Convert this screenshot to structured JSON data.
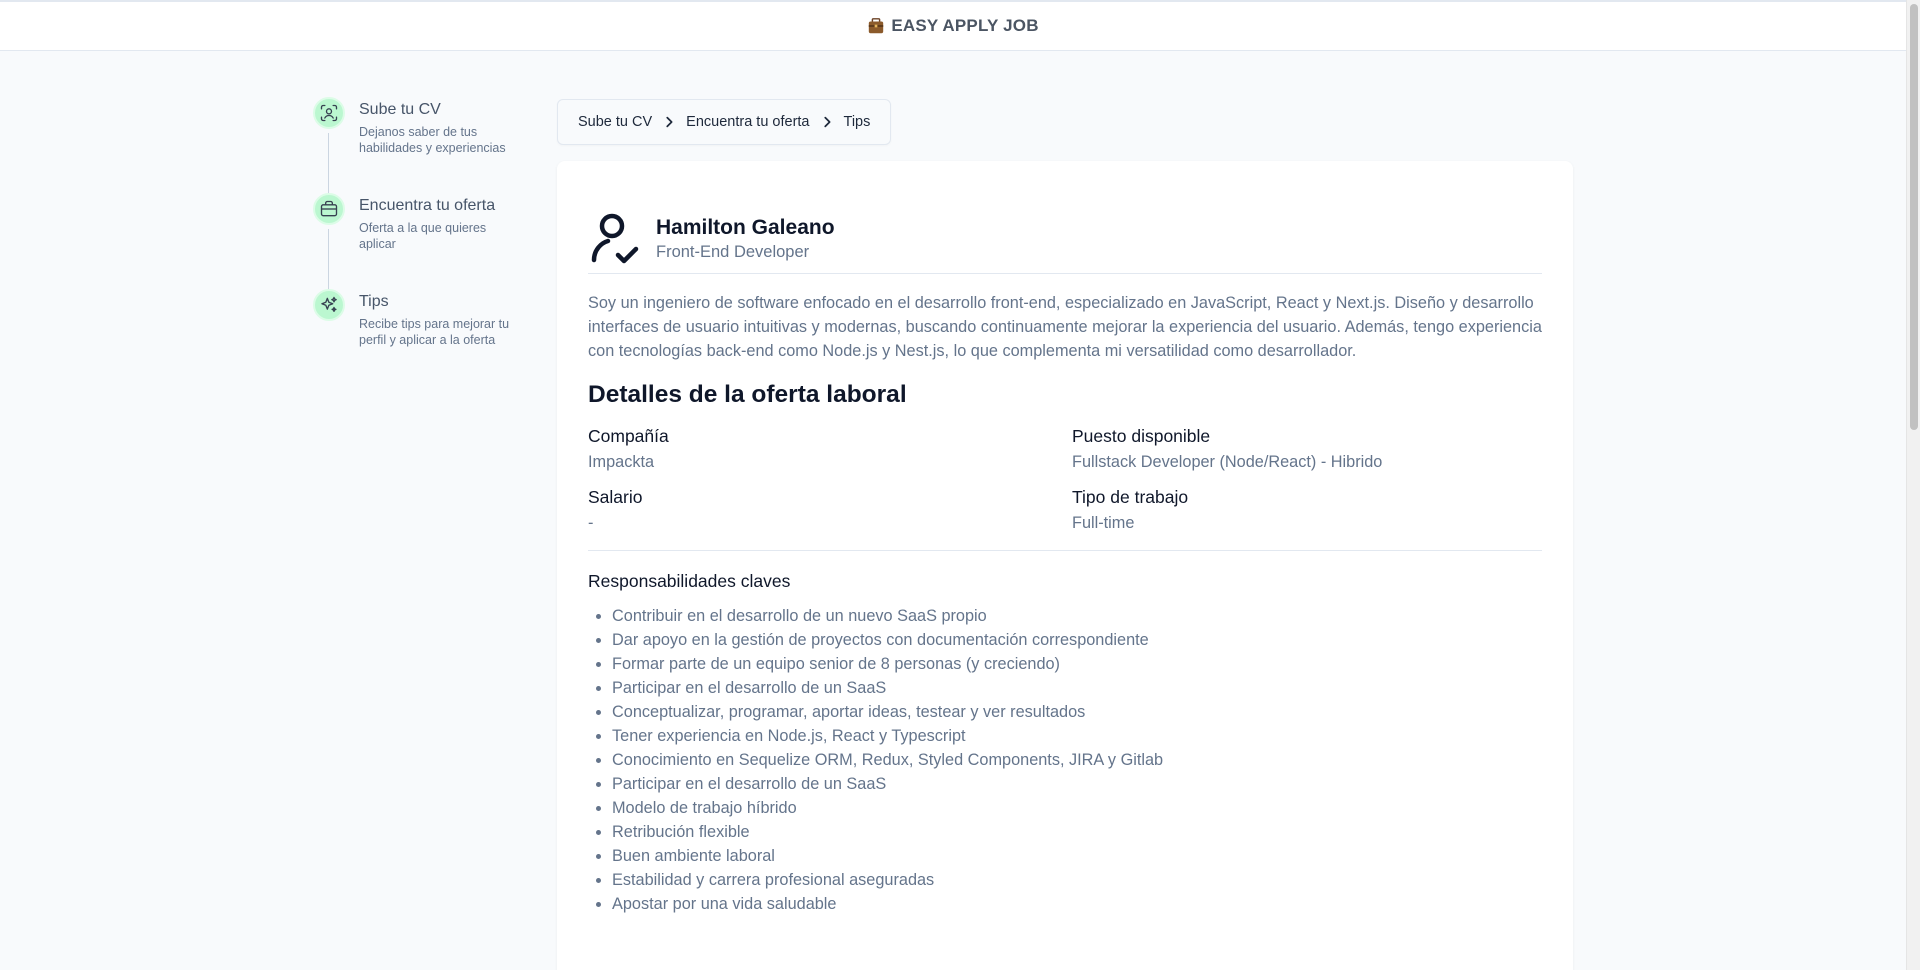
{
  "header": {
    "brand": "EASY APPLY JOB",
    "brand_icon": "briefcase-icon"
  },
  "stepper": {
    "steps": [
      {
        "title": "Sube tu CV",
        "desc": "Dejanos saber de tus habilidades y experiencias",
        "icon": "scan-user-icon"
      },
      {
        "title": "Encuentra tu oferta",
        "desc": "Oferta a la que quieres aplicar",
        "icon": "briefcase-icon"
      },
      {
        "title": "Tips",
        "desc": "Recibe tips para mejorar tu perfil y aplicar a la oferta",
        "icon": "sparkles-icon"
      }
    ],
    "accent": "#bbf7d0"
  },
  "breadcrumb": {
    "items": [
      "Sube tu CV",
      "Encuentra tu oferta",
      "Tips"
    ]
  },
  "profile": {
    "name": "Hamilton Galeano",
    "role": "Front-End Developer",
    "bio": "Soy un ingeniero de software enfocado en el desarrollo front-end, especializado en JavaScript, React y Next.js. Diseño y desarrollo interfaces de usuario intuitivas y modernas, buscando continuamente mejorar la experiencia del usuario. Además, tengo experiencia con tecnologías back-end como Node.js y Nest.js, lo que complementa mi versatilidad como desarrollador."
  },
  "offer": {
    "section_title": "Detalles de la oferta laboral",
    "company_label": "Compañía",
    "company_value": "Impackta",
    "position_label": "Puesto disponible",
    "position_value": "Fullstack Developer (Node/React) - Hibrido",
    "salary_label": "Salario",
    "salary_value": "-",
    "job_type_label": "Tipo de trabajo",
    "job_type_value": "Full-time"
  },
  "responsibilities": {
    "title": "Responsabilidades claves",
    "items": [
      "Contribuir en el desarrollo de un nuevo SaaS propio",
      "Dar apoyo en la gestión de proyectos con documentación correspondiente",
      "Formar parte de un equipo senior de 8 personas (y creciendo)",
      "Participar en el desarrollo de un SaaS",
      "Conceptualizar, programar, aportar ideas, testear y ver resultados",
      "Tener experiencia en Node.js, React y Typescript",
      "Conocimiento en Sequelize ORM, Redux, Styled Components, JIRA y Gitlab",
      "Participar en el desarrollo de un SaaS",
      "Modelo de trabajo híbrido",
      "Retribución flexible",
      "Buen ambiente laboral",
      "Estabilidad y carrera profesional aseguradas",
      "Apostar por una vida saludable"
    ]
  }
}
